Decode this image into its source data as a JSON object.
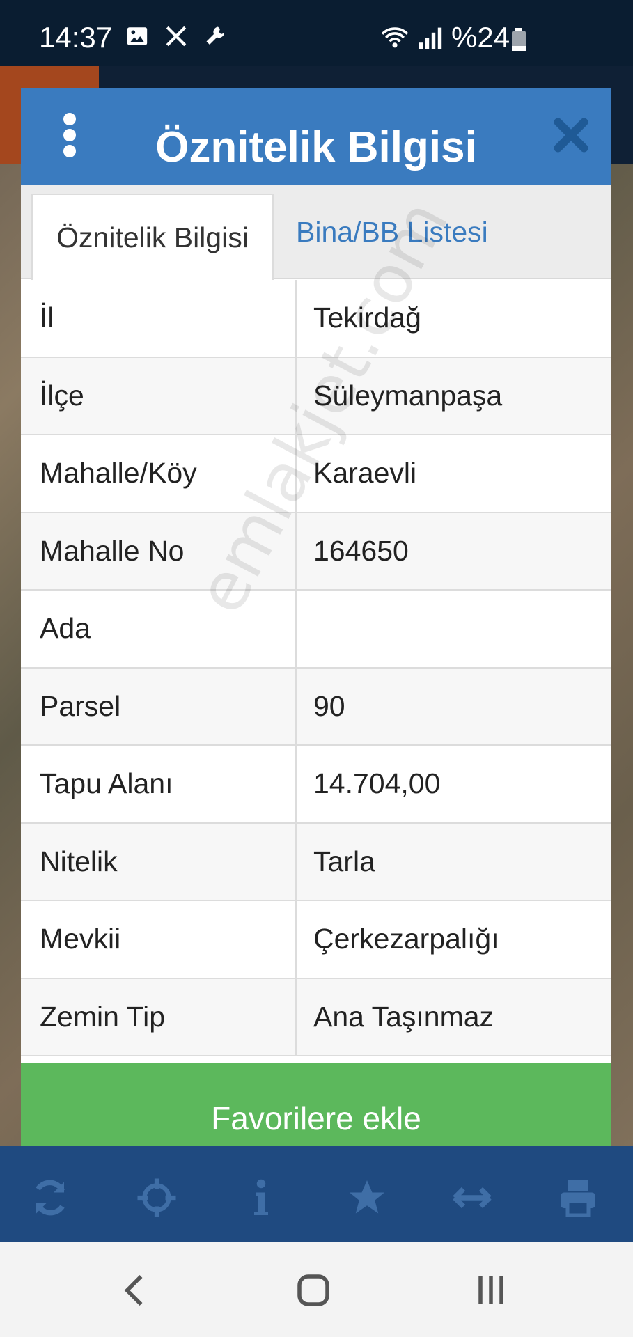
{
  "status_bar": {
    "time": "14:37",
    "battery": "%24",
    "icons": [
      "gallery-icon",
      "x-logo-icon",
      "wrench-icon",
      "wifi-icon",
      "signal-icon",
      "battery-icon"
    ]
  },
  "dialog": {
    "title": "Öznitelik Bilgisi",
    "tabs": [
      {
        "label": "Öznitelik Bilgisi",
        "active": true
      },
      {
        "label": "Bina/BB Listesi",
        "active": false
      }
    ],
    "rows": [
      {
        "key": "İl",
        "value": "Tekirdağ"
      },
      {
        "key": "İlçe",
        "value": "Süleymanpaşa"
      },
      {
        "key": "Mahalle/Köy",
        "value": "Karaevli"
      },
      {
        "key": "Mahalle No",
        "value": "164650"
      },
      {
        "key": "Ada",
        "value": ""
      },
      {
        "key": "Parsel",
        "value": "90"
      },
      {
        "key": "Tapu Alanı",
        "value": "14.704,00"
      },
      {
        "key": "Nitelik",
        "value": "Tarla"
      },
      {
        "key": "Mevkii",
        "value": "Çerkezarpalığı"
      },
      {
        "key": "Zemin Tip",
        "value": "Ana Taşınmaz"
      }
    ],
    "favorite_button": "Favorilere ekle",
    "watermark": "emlakjet.com"
  },
  "colors": {
    "header": "#3a7bbf",
    "favorite_button": "#5cb85c",
    "toolbar": "#1f4a80"
  },
  "toolbar_icons": [
    "refresh-icon",
    "crosshair-icon",
    "info-icon",
    "star-icon",
    "resize-icon",
    "print-icon"
  ],
  "nav_icons": [
    "back-icon",
    "home-icon",
    "recents-icon"
  ]
}
